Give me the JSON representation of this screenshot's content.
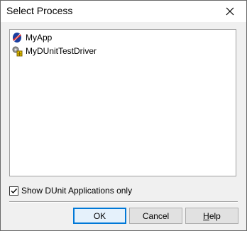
{
  "window": {
    "title": "Select Process"
  },
  "titlebar": {
    "close_icon": "close-icon"
  },
  "process_list": {
    "items": [
      {
        "label": "MyApp",
        "icon": "delphi-app-icon"
      },
      {
        "label": "MyDUnitTestDriver",
        "icon": "dunit-test-driver-icon"
      }
    ]
  },
  "options": {
    "show_dunit_only": {
      "label": "Show DUnit Applications only",
      "checked": true
    }
  },
  "buttons": {
    "ok": "OK",
    "cancel": "Cancel",
    "help_prefix": "",
    "help_underline": "H",
    "help_rest": "elp"
  },
  "colors": {
    "accent": "#0078d7",
    "title_bg": "#ffffff",
    "dialog_bg": "#f0f0f0"
  }
}
